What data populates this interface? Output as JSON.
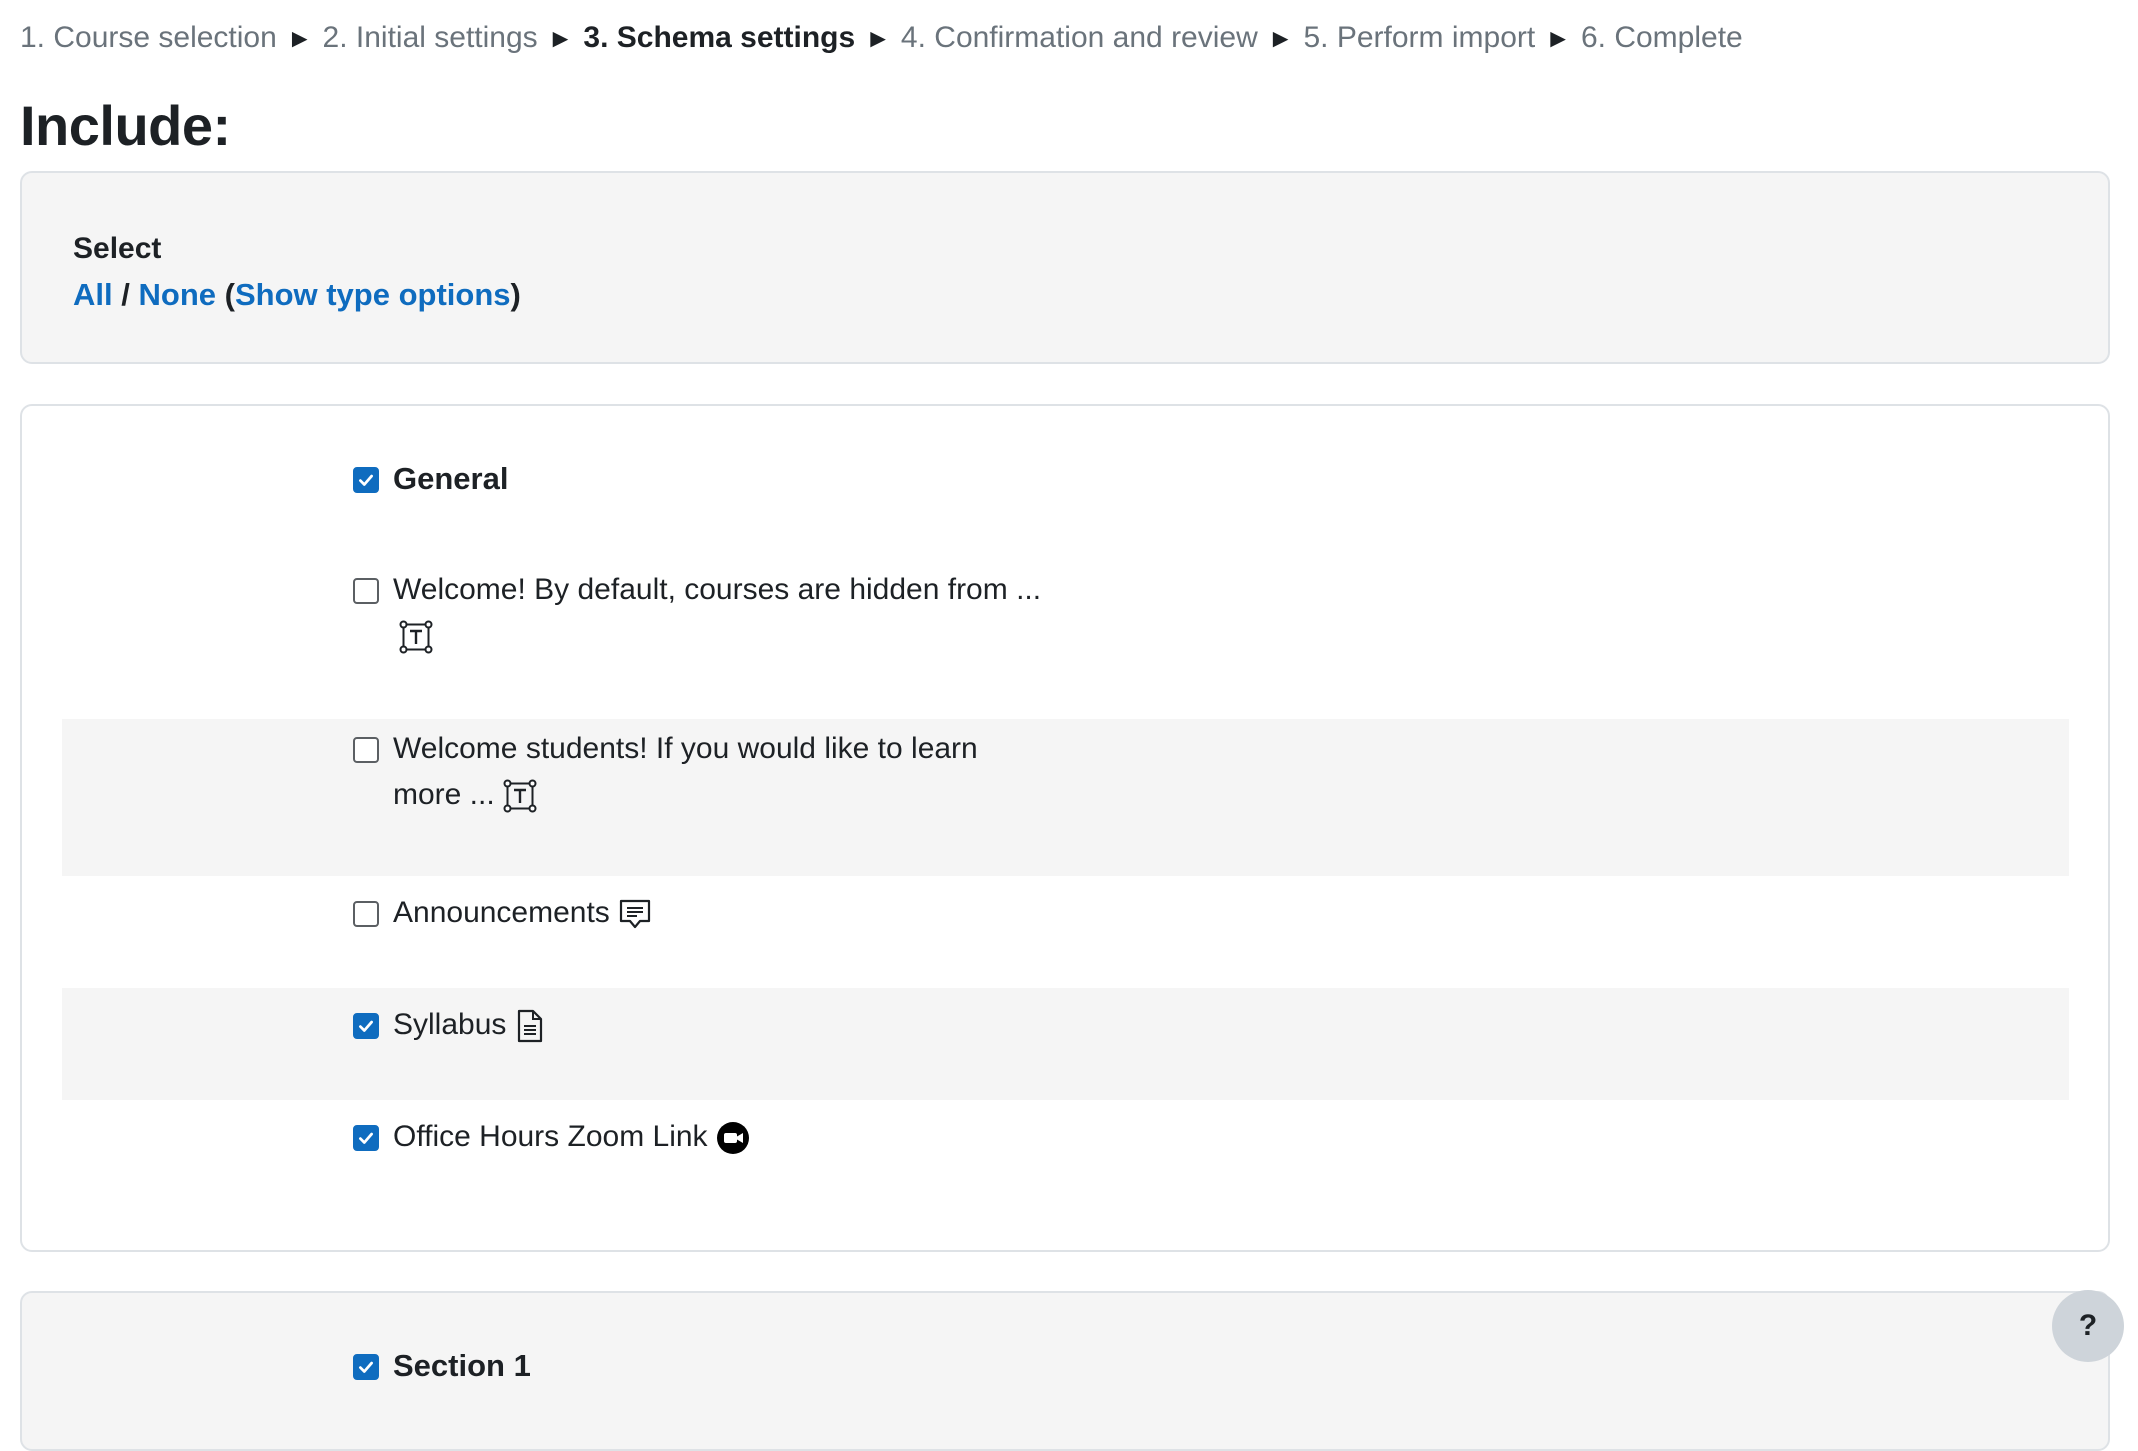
{
  "breadcrumb": {
    "steps": [
      {
        "label": "1. Course selection"
      },
      {
        "label": "2. Initial settings"
      },
      {
        "label": "3. Schema settings"
      },
      {
        "label": "4. Confirmation and review"
      },
      {
        "label": "5. Perform import"
      },
      {
        "label": "6. Complete"
      }
    ],
    "separator": "►",
    "current_index": 2
  },
  "page_title": "Include:",
  "select_panel": {
    "label": "Select",
    "all_link": "All",
    "slash": "/",
    "none_link": "None",
    "open_paren": "(",
    "show_type_options_link": "Show type options",
    "close_paren": ")"
  },
  "general_section": {
    "heading": {
      "label": "General",
      "checked": true
    },
    "items": [
      {
        "label": "Welcome! By default, courses are hidden from ...",
        "checked": false,
        "icon": "text-and-media-area-icon"
      },
      {
        "label_line1": "Welcome students! If you would like to learn",
        "label_line2": "more ...",
        "checked": false,
        "icon": "text-and-media-area-icon"
      },
      {
        "label": "Announcements",
        "checked": false,
        "icon": "forum-icon"
      },
      {
        "label": "Syllabus",
        "checked": true,
        "icon": "file-document-icon"
      },
      {
        "label": "Office Hours Zoom Link",
        "checked": true,
        "icon": "zoom-video-icon"
      }
    ]
  },
  "section_1": {
    "heading": {
      "label": "Section 1",
      "checked": true
    }
  },
  "help_button": {
    "label": "?"
  },
  "colors": {
    "link": "#0f6cbf",
    "checkbox_checked": "#0f6cbf",
    "panel_bg": "#f5f5f5",
    "muted_text": "#6a737b",
    "border": "#dee2e6"
  }
}
